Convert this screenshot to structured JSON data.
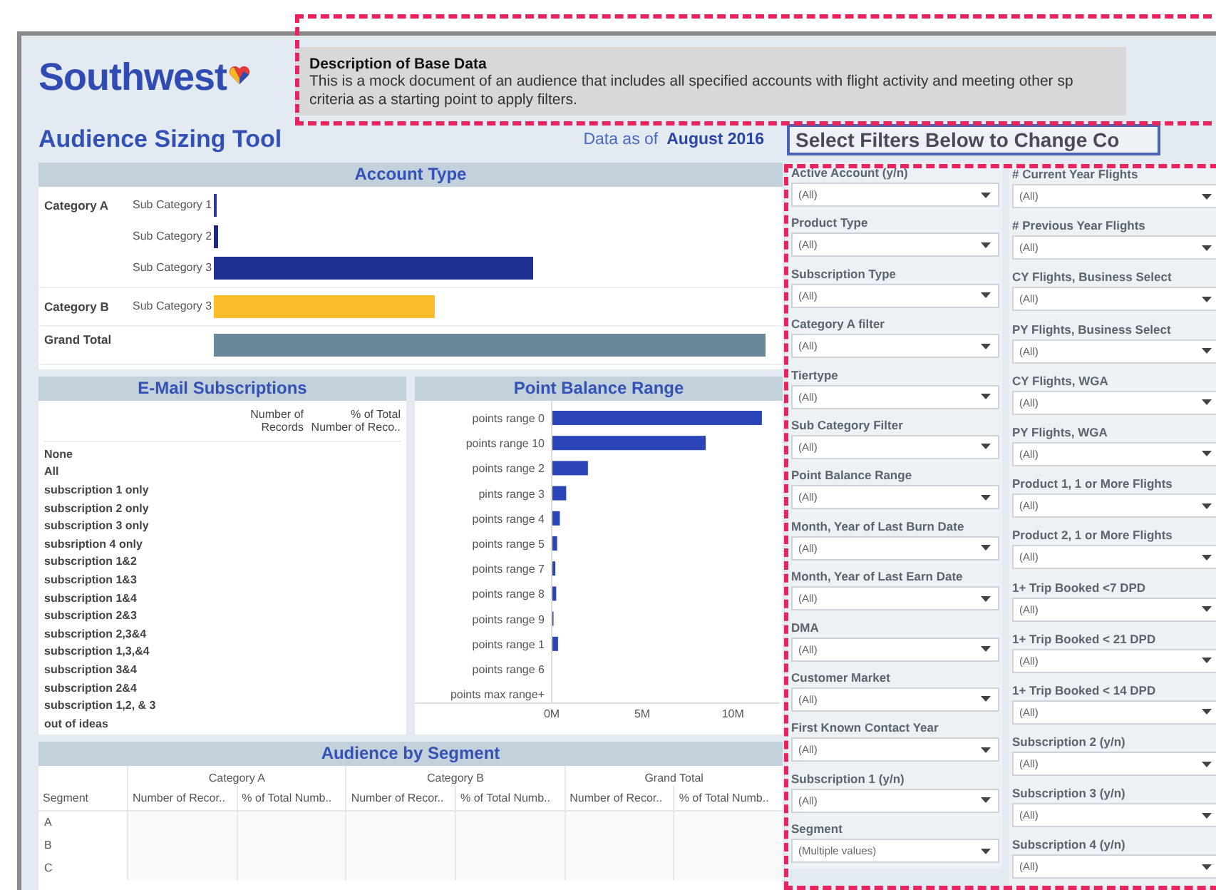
{
  "header": {
    "logo": "Southwest",
    "description_title": "Description of Base Data",
    "description": "This is a mock document of an audience that includes all specified accounts with flight activity and meeting other sp criteria as a starting point to apply filters.",
    "title": "Audience Sizing Tool",
    "data_as_of_label": "Data as of",
    "data_as_of": "August 2016",
    "filters_title": "Select Filters Below to Change Co"
  },
  "account_type": {
    "title": "Account Type",
    "groups": [
      {
        "label": "Category A",
        "bars": [
          {
            "label": "Sub Category 1",
            "color": "#2a3a9a"
          },
          {
            "label": "Sub Category 2",
            "color": "#1c2a80"
          },
          {
            "label": "Sub Category 3",
            "color": "#1f2f8f"
          }
        ]
      },
      {
        "label": "Category B",
        "bars": [
          {
            "label": "Sub Category 3",
            "color": "#fbbd2a"
          }
        ]
      }
    ],
    "grand_total": {
      "label": "Grand Total",
      "color": "#6b879c"
    }
  },
  "email_subscriptions": {
    "title": "E-Mail Subscriptions",
    "columns": [
      "Number of Records",
      "% of Total Number of Reco.."
    ],
    "rows": [
      "None",
      "All",
      "subscription 1 only",
      "subscription 2 only",
      "subscription 3 only",
      "subsription 4 only",
      "subscription 1&2",
      "subscription 1&3",
      "subscription 1&4",
      "subscription 2&3",
      "subscription 2,3&4",
      "subscription 1,3,&4",
      "subscription 3&4",
      "subscription 2&4",
      "subscription 1,2, & 3",
      "out of ideas"
    ]
  },
  "point_balance": {
    "title": "Point Balance Range",
    "chart_data": {
      "type": "bar",
      "orientation": "horizontal",
      "categories": [
        "points range 0",
        "points range 10",
        "points range 2",
        "pints range 3",
        "points range 4",
        "points range 5",
        "points range 7",
        "points range 8",
        "points range 9",
        "points range 1",
        "points range 6",
        "points max range+"
      ],
      "series": [
        {
          "color": "#2b45b8",
          "values": [
            11.6,
            8.5,
            2.0,
            0.8,
            0.45,
            0.3,
            0.2,
            0.25,
            0.1,
            0.35,
            0,
            0
          ]
        }
      ],
      "xlim": [
        0,
        11.8
      ],
      "xticks": [
        {
          "value": 0,
          "label": "0M"
        },
        {
          "value": 5,
          "label": "5M"
        },
        {
          "value": 10,
          "label": "10M"
        }
      ]
    }
  },
  "segment_table": {
    "title": "Audience by Segment",
    "groups": [
      "Category A",
      "Category B",
      "Grand Total"
    ],
    "row_header": "Segment",
    "columns": [
      "Number of Recor..",
      "% of Total Numb..",
      "Number of Recor..",
      "% of Total Numb..",
      "Number of Recor..",
      "% of Total Numb.."
    ],
    "rows": [
      "A",
      "B",
      "C"
    ]
  },
  "filters": {
    "left": [
      {
        "label": "Active Account (y/n)",
        "value": "(All)"
      },
      {
        "label": "Product Type",
        "value": "(All)"
      },
      {
        "label": "Subscription Type",
        "value": "(All)"
      },
      {
        "label": "Category A filter",
        "value": "(All)"
      },
      {
        "label": "Tiertype",
        "value": "(All)"
      },
      {
        "label": "Sub Category Filter",
        "value": "(All)"
      },
      {
        "label": "Point Balance Range",
        "value": "(All)"
      },
      {
        "label": "Month, Year of Last Burn Date",
        "value": "(All)"
      },
      {
        "label": "Month, Year of Last Earn Date",
        "value": "(All)"
      },
      {
        "label": "DMA",
        "value": "(All)"
      },
      {
        "label": "Customer Market",
        "value": "(All)"
      },
      {
        "label": "First Known Contact Year",
        "value": "(All)"
      },
      {
        "label": "Subscription 1 (y/n)",
        "value": "(All)"
      },
      {
        "label": "Segment",
        "value": "(Multiple values)"
      }
    ],
    "right": [
      {
        "label": "# Current Year Flights",
        "value": "(All)"
      },
      {
        "label": "# Previous Year Flights",
        "value": "(All)"
      },
      {
        "label": "CY Flights, Business Select",
        "value": "(All)"
      },
      {
        "label": "PY Flights, Business Select",
        "value": "(All)"
      },
      {
        "label": "CY Flights, WGA",
        "value": "(All)"
      },
      {
        "label": "PY Flights, WGA",
        "value": "(All)"
      },
      {
        "label": "Product 1, 1 or More Flights",
        "value": "(All)"
      },
      {
        "label": "Product 2, 1 or More Flights",
        "value": "(All)"
      },
      {
        "label": "1+ Trip Booked <7 DPD",
        "value": "(All)"
      },
      {
        "label": "1+ Trip Booked < 21 DPD",
        "value": "(All)"
      },
      {
        "label": "1+ Trip Booked < 14 DPD",
        "value": "(All)"
      },
      {
        "label": "Subscription 2 (y/n)",
        "value": "(All)"
      },
      {
        "label": "Subscription 3 (y/n)",
        "value": "(All)"
      },
      {
        "label": "Subscription 4 (y/n)",
        "value": "(All)"
      }
    ]
  }
}
